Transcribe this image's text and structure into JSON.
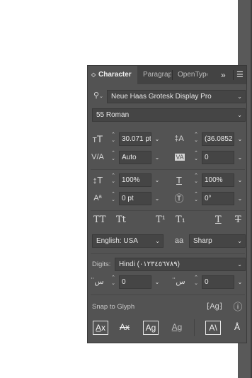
{
  "panel": {
    "tabs": {
      "character": "Character",
      "paragraph": "Paragraph",
      "opentype": "OpenType",
      "more": "»",
      "menu": "☰"
    },
    "font_family": "Neue Haas Grotesk Display Pro",
    "font_style": "55 Roman",
    "font_size": "30.071 pt",
    "leading": "(36.0852",
    "kerning": "Auto",
    "tracking": "0",
    "vertical_scale": "100%",
    "horizontal_scale": "100%",
    "baseline_shift": "0 pt",
    "rotation": "0°",
    "language": "English: USA",
    "anti_alias_icon_text": "aa",
    "anti_alias": "Sharp",
    "digits_label": "Digits:",
    "digits_value": "Hindi (٠١٢٣٤٥٦٧٨٩)",
    "arabic_field_1": "0",
    "arabic_field_2": "0",
    "snap_label": "Snap to Glyph",
    "caps_buttons": [
      "TT",
      "Tt",
      "T¹",
      "T₁",
      "T",
      "T"
    ]
  },
  "icons": {
    "search": "magnifier-icon",
    "info": "info-icon"
  },
  "colors": {
    "panel_bg": "#535353",
    "tab_bar": "#434343",
    "field_bg": "#454545",
    "strip": "#595959"
  }
}
